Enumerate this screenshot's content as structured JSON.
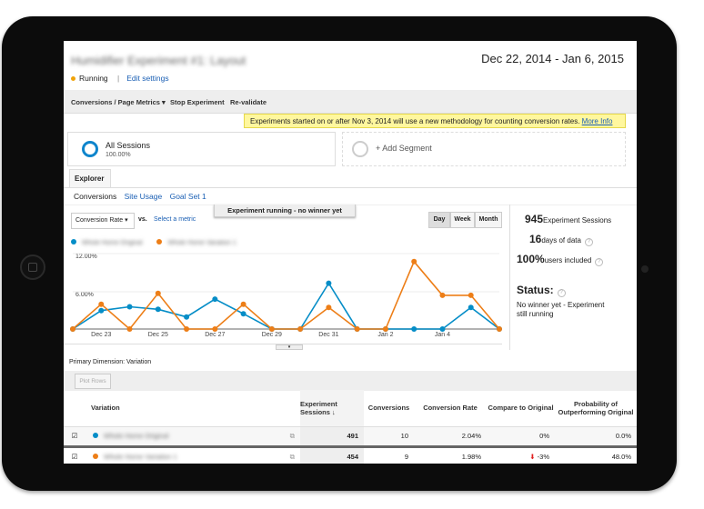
{
  "header": {
    "title": "Humidifier Experiment #1: Layout",
    "status": "Running",
    "edit_settings": "Edit settings",
    "date_range": "Dec 22, 2014 - Jan 6, 2015",
    "status_color": "#f0a30a"
  },
  "toolbar": {
    "metrics": "Conversions / Page Metrics",
    "stop": "Stop Experiment",
    "revalidate": "Re-validate"
  },
  "notice": {
    "text": "Experiments started on or after Nov 3, 2014 will use a new methodology for counting conversion rates.",
    "link": "More Info"
  },
  "segments": {
    "all_label": "All Sessions",
    "all_pct": "100.00%",
    "add": "+ Add Segment"
  },
  "explorer": {
    "tab": "Explorer",
    "subtabs": [
      "Conversions",
      "Site Usage",
      "Goal Set 1"
    ]
  },
  "controls": {
    "metric": "Conversion Rate",
    "vs": "vs.",
    "select_metric": "Select a metric",
    "banner": "Experiment running - no winner yet",
    "periods": [
      "Day",
      "Week",
      "Month"
    ],
    "active_period": "Day"
  },
  "stats": {
    "sessions": "945",
    "sessions_label": "Experiment Sessions",
    "days": "16",
    "days_label": "days of data",
    "users": "100%",
    "users_label": "users included",
    "status_label": "Status:",
    "status_text": "No winner yet - Experiment still running"
  },
  "chart_data": {
    "type": "line",
    "x": [
      "Dec 22",
      "Dec 23",
      "Dec 24",
      "Dec 25",
      "Dec 26",
      "Dec 27",
      "Dec 28",
      "Dec 29",
      "Dec 30",
      "Dec 31",
      "Jan 1",
      "Jan 2",
      "Jan 3",
      "Jan 4",
      "Jan 5",
      "Jan 6"
    ],
    "x_tick_labels": [
      "Dec 23",
      "Dec 25",
      "Dec 27",
      "Dec 29",
      "Dec 31",
      "Jan 2",
      "Jan 4"
    ],
    "y_tick_labels": [
      "6.00%",
      "12.00%"
    ],
    "ylim": [
      0,
      12.5
    ],
    "grid": true,
    "legend_placement": "top-left",
    "series": [
      {
        "name": "Whole Home Original",
        "color": "#058dc7",
        "values": [
          0,
          2.9,
          3.5,
          3.1,
          1.9,
          4.7,
          2.4,
          0,
          0,
          7.2,
          0,
          0,
          0,
          0,
          3.4,
          0
        ]
      },
      {
        "name": "Whole Home Variation 1",
        "color": "#ed7e17",
        "values": [
          0,
          3.9,
          0,
          5.6,
          0,
          0,
          3.9,
          0,
          0,
          3.4,
          0,
          0,
          10.6,
          5.3,
          5.3,
          0
        ]
      }
    ]
  },
  "table": {
    "primary_dimension_label": "Primary Dimension:",
    "primary_dimension": "Variation",
    "plot_rows": "Plot Rows",
    "columns": [
      "Variation",
      "Experiment Sessions",
      "Conversions",
      "Conversion Rate",
      "Compare to Original",
      "Probability of Outperforming Original"
    ],
    "rows": [
      {
        "name": "Whole Home Original",
        "color": "#058dc7",
        "sessions": "491",
        "conversions": "10",
        "rate": "2.04%",
        "compare": "0%",
        "probability": "0.0%"
      },
      {
        "name": "Whole Home Variation 1",
        "color": "#ed7e17",
        "sessions": "454",
        "conversions": "9",
        "rate": "1.98%",
        "compare": "-3%",
        "probability": "48.0%"
      }
    ]
  }
}
